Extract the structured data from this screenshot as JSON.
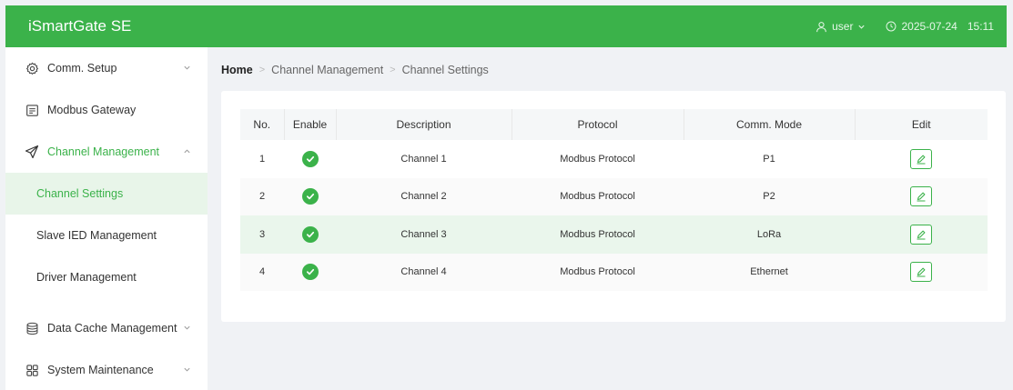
{
  "app": {
    "title": "iSmartGate SE"
  },
  "header": {
    "user_label": "user",
    "date": "2025-07-24",
    "time": "15:11"
  },
  "sidebar": {
    "items": [
      {
        "label": "Comm. Setup",
        "icon": "settings-icon"
      },
      {
        "label": "Modbus Gateway",
        "icon": "gateway-icon"
      },
      {
        "label": "Channel Management",
        "icon": "send-icon",
        "expanded": true
      },
      {
        "label": "Data Cache Management",
        "icon": "database-icon"
      },
      {
        "label": "System Maintenance",
        "icon": "apps-icon"
      }
    ],
    "sub_items": [
      {
        "label": "Channel Settings",
        "active": true
      },
      {
        "label": "Slave IED Management"
      },
      {
        "label": "Driver Management"
      }
    ]
  },
  "breadcrumb": {
    "home": "Home",
    "level1": "Channel Management",
    "level2": "Channel Settings"
  },
  "table": {
    "headers": [
      "No.",
      "Enable",
      "Description",
      "Protocol",
      "Comm. Mode",
      "Edit"
    ],
    "rows": [
      {
        "no": "1",
        "enabled": true,
        "description": "Channel 1",
        "protocol": "Modbus Protocol",
        "mode": "P1"
      },
      {
        "no": "2",
        "enabled": true,
        "description": "Channel 2",
        "protocol": "Modbus Protocol",
        "mode": "P2"
      },
      {
        "no": "3",
        "enabled": true,
        "description": "Channel 3",
        "protocol": "Modbus Protocol",
        "mode": "LoRa"
      },
      {
        "no": "4",
        "enabled": true,
        "description": "Channel 4",
        "protocol": "Modbus Protocol",
        "mode": "Ethernet"
      }
    ]
  },
  "colors": {
    "accent": "#3bb24a",
    "active_bg": "#e8f5e9"
  }
}
